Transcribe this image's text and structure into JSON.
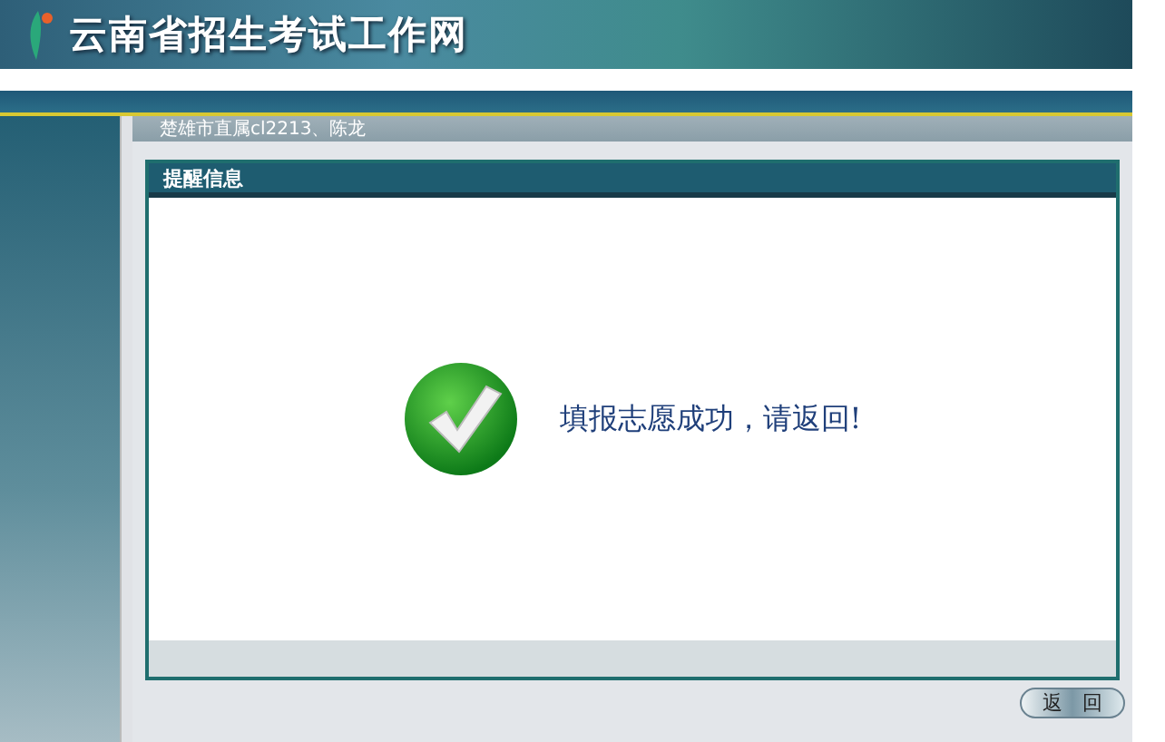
{
  "header": {
    "title": "云南省招生考试工作网"
  },
  "user_line": "楚雄市直属cl2213、陈龙",
  "panel": {
    "title": "提醒信息",
    "message": "填报志愿成功，请返回!"
  },
  "buttons": [
    "返　回"
  ]
}
